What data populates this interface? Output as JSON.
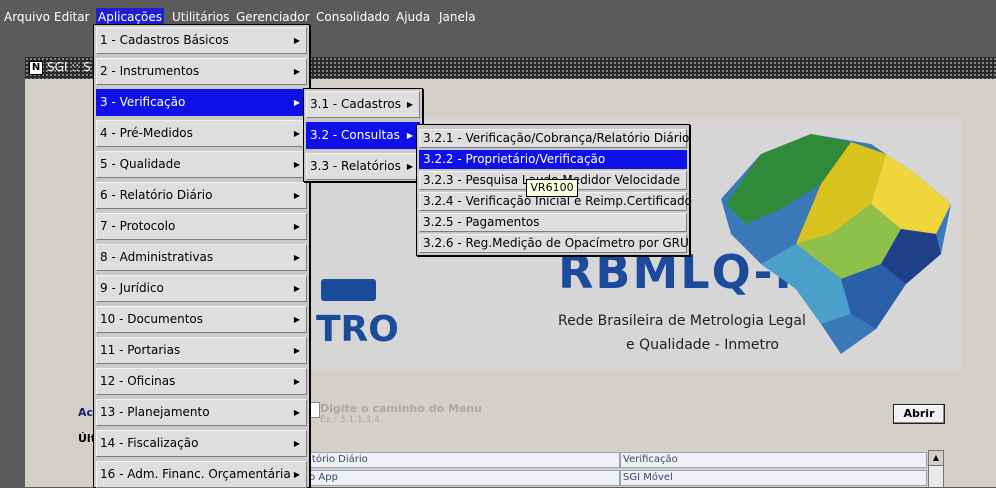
{
  "menubar": {
    "items": [
      "Arquivo",
      "Editar",
      "Aplicações",
      "Utilitários",
      "Gerenciador",
      "Consolidado",
      "Ajuda",
      "Janela"
    ],
    "active_index": 2
  },
  "window": {
    "title": "SGI :: S",
    "icon_letter": "N"
  },
  "logo": {
    "main": "RBMLQ-I",
    "tro": "TRO",
    "subtitle_1": "Rede Brasileira de Metrologia Legal",
    "subtitle_2": "e Qualidade - Inmetro"
  },
  "lower_panel": {
    "acc_label": "Ac",
    "ult_label": "Últ",
    "menu_path_label": "Digite o caminho do Menu",
    "menu_path_example": "Ex.: 3.1.1.3.4",
    "open_button": "Abrir",
    "grid": [
      [
        "latório Diário",
        "Verificação"
      ],
      [
        "ão App",
        "SGI Móvel"
      ]
    ]
  },
  "menu_level1": {
    "items": [
      "1 - Cadastros Básicos",
      "2 - Instrumentos",
      "3 - Verificação",
      "4 - Pré-Medidos",
      "5 - Qualidade",
      "6 - Relatório Diário",
      "7 - Protocolo",
      "8 - Administrativas",
      "9 - Jurídico",
      "10 - Documentos",
      "11 - Portarias",
      "12 - Oficinas",
      "13 - Planejamento",
      "14 - Fiscalização",
      "16 - Adm. Financ. Orçamentária"
    ],
    "selected_index": 2
  },
  "menu_level2": {
    "items": [
      "3.1 - Cadastros",
      "3.2 - Consultas",
      "3.3 - Relatórios"
    ],
    "selected_index": 1
  },
  "menu_level3": {
    "items": [
      "3.2.1 - Verificação/Cobrança/Relatório Diário",
      "3.2.2 - Proprietário/Verificação",
      "3.2.3 - Pesquisa Laudo Medidor Velocidade",
      "3.2.4 - Verificação Inicial e Reimp.Certificado",
      "3.2.5 - Pagamentos",
      "3.2.6 - Reg.Medição de Opacímetro por GRU"
    ],
    "selected_index": 1
  },
  "tooltip": "VR6100",
  "icons": {
    "arrow": "right-triangle",
    "scroll_up": "up-triangle"
  },
  "colors": {
    "menu_highlight": "#1010e8",
    "menubar_bg": "#5b5b5b",
    "brand_blue": "#1b4b9a",
    "tooltip_bg": "#ffffe1"
  }
}
